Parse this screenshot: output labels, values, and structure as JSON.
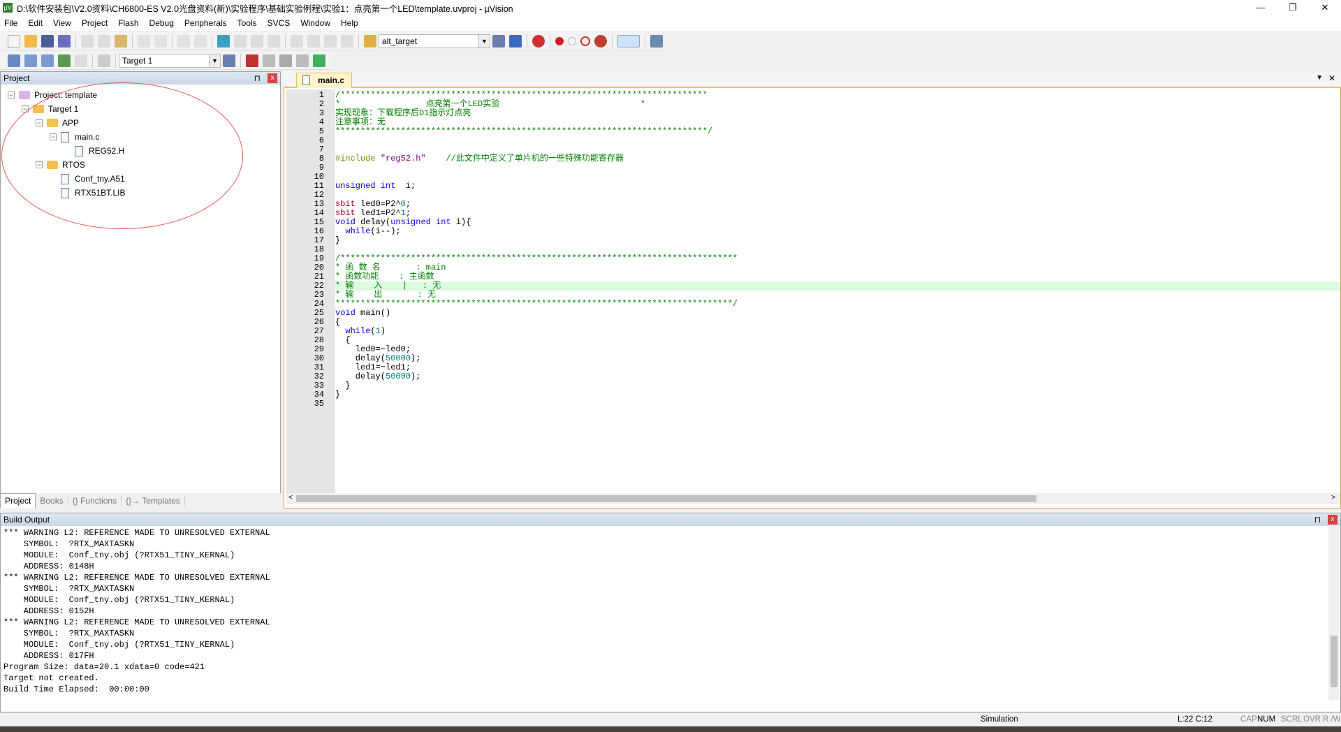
{
  "window": {
    "title": "D:\\软件安装包\\V2.0资料\\CH6800-ES V2.0光盘资料(新)\\实验程序\\基础实验例程\\实验1：点亮第一个LED\\template.uvproj - µVision",
    "minimize": "—",
    "restore": "❐",
    "close": "✕"
  },
  "menu": [
    "File",
    "Edit",
    "View",
    "Project",
    "Flash",
    "Debug",
    "Peripherals",
    "Tools",
    "SVCS",
    "Window",
    "Help"
  ],
  "toolbar": {
    "target_combo": "alt_target",
    "build_target": "Target 1"
  },
  "project": {
    "title": "Project",
    "pin": "⊓",
    "close": "x",
    "tree": [
      {
        "label": "Project: template",
        "level": 0,
        "icon": "project-icon",
        "expanded": true
      },
      {
        "label": "Target 1",
        "level": 1,
        "icon": "target-folder-icon",
        "expanded": true
      },
      {
        "label": "APP",
        "level": 2,
        "icon": "folder-icon",
        "expanded": true
      },
      {
        "label": "main.c",
        "level": 3,
        "icon": "file-icon",
        "expanded": true
      },
      {
        "label": "REG52.H",
        "level": 4,
        "icon": "file-icon"
      },
      {
        "label": "RTOS",
        "level": 2,
        "icon": "folder-icon",
        "expanded": true
      },
      {
        "label": "Conf_tny.A51",
        "level": 3,
        "icon": "file-icon"
      },
      {
        "label": "RTX51BT.LIB",
        "level": 3,
        "icon": "file-icon"
      }
    ],
    "tabs": [
      "Project",
      "Books",
      "{} Functions",
      "{}→ Templates"
    ],
    "annotation_color": "#e85a5a"
  },
  "editor": {
    "tab": "main.c",
    "current_line": 22,
    "lines": [
      [
        [
          "c",
          "/*************************************************************************"
        ]
      ],
      [
        [
          "c",
          "*                 点亮第一个LED实验                            *"
        ]
      ],
      [
        [
          "c",
          "实现现象：下载程序后D1指示灯点亮"
        ]
      ],
      [
        [
          "c",
          "注意事项：无"
        ]
      ],
      [
        [
          "c",
          "**************************************************************************/"
        ]
      ],
      [],
      [],
      [
        [
          "p",
          "#include "
        ],
        [
          "s",
          "\"reg52.h\""
        ],
        [
          "c",
          "    //此文件中定义了单片机的一些特殊功能寄存器"
        ]
      ],
      [],
      [],
      [
        [
          "k",
          "unsigned int"
        ],
        [
          "",
          "  i;"
        ]
      ],
      [],
      [
        [
          "r",
          "sbit"
        ],
        [
          "",
          " led0=P2^"
        ],
        [
          "n",
          "0"
        ],
        [
          "",
          ";"
        ]
      ],
      [
        [
          "r",
          "sbit"
        ],
        [
          "",
          " led1=P2^"
        ],
        [
          "n",
          "1"
        ],
        [
          "",
          ";"
        ]
      ],
      [
        [
          "k",
          "void"
        ],
        [
          "",
          " delay("
        ],
        [
          "k",
          "unsigned int"
        ],
        [
          "",
          " i){"
        ]
      ],
      [
        [
          "",
          "  "
        ],
        [
          "k",
          "while"
        ],
        [
          "",
          "(i--);"
        ]
      ],
      [
        [
          "",
          "}"
        ]
      ],
      [],
      [
        [
          "c",
          "/*******************************************************************************"
        ]
      ],
      [
        [
          "c",
          "* 函 数 名       : main"
        ]
      ],
      [
        [
          "c",
          "* 函数功能    : 主函数"
        ]
      ],
      [
        [
          "c",
          "* 输    入    |   : 无"
        ]
      ],
      [
        [
          "c",
          "* 输    出       : 无"
        ]
      ],
      [
        [
          "c",
          "*******************************************************************************/"
        ]
      ],
      [
        [
          "k",
          "void"
        ],
        [
          "",
          " main()"
        ]
      ],
      [
        [
          "",
          "{"
        ]
      ],
      [
        [
          "",
          "  "
        ],
        [
          "k",
          "while"
        ],
        [
          "",
          "("
        ],
        [
          "n",
          "1"
        ],
        [
          "",
          ")"
        ]
      ],
      [
        [
          "",
          "  {"
        ]
      ],
      [
        [
          "",
          "    led0=~led0;"
        ]
      ],
      [
        [
          "",
          "    delay("
        ],
        [
          "n",
          "50000"
        ],
        [
          "",
          ");"
        ]
      ],
      [
        [
          "",
          "    led1=~led1;"
        ]
      ],
      [
        [
          "",
          "    delay("
        ],
        [
          "n",
          "50000"
        ],
        [
          "",
          ");"
        ]
      ],
      [
        [
          "",
          "  }"
        ]
      ],
      [
        [
          "",
          "}"
        ]
      ],
      []
    ]
  },
  "build": {
    "title": "Build Output",
    "lines": [
      "*** WARNING L2: REFERENCE MADE TO UNRESOLVED EXTERNAL",
      "    SYMBOL:  ?RTX_MAXTASKN",
      "    MODULE:  Conf_tny.obj (?RTX51_TINY_KERNAL)",
      "    ADDRESS: 0148H",
      "*** WARNING L2: REFERENCE MADE TO UNRESOLVED EXTERNAL",
      "    SYMBOL:  ?RTX_MAXTASKN",
      "    MODULE:  Conf_tny.obj (?RTX51_TINY_KERNAL)",
      "    ADDRESS: 0152H",
      "*** WARNING L2: REFERENCE MADE TO UNRESOLVED EXTERNAL",
      "    SYMBOL:  ?RTX_MAXTASKN",
      "    MODULE:  Conf_tny.obj (?RTX51_TINY_KERNAL)",
      "    ADDRESS: 017FH",
      "Program Size: data=20.1 xdata=0 code=421",
      "Target not created.",
      "Build Time Elapsed:  00:00:00"
    ]
  },
  "status": {
    "mode": "Simulation",
    "position": "L:22 C:12",
    "cap": "CAP",
    "num": "NUM",
    "scrl": "SCRL",
    "ovr": "OVR",
    "rw": "R /W"
  }
}
